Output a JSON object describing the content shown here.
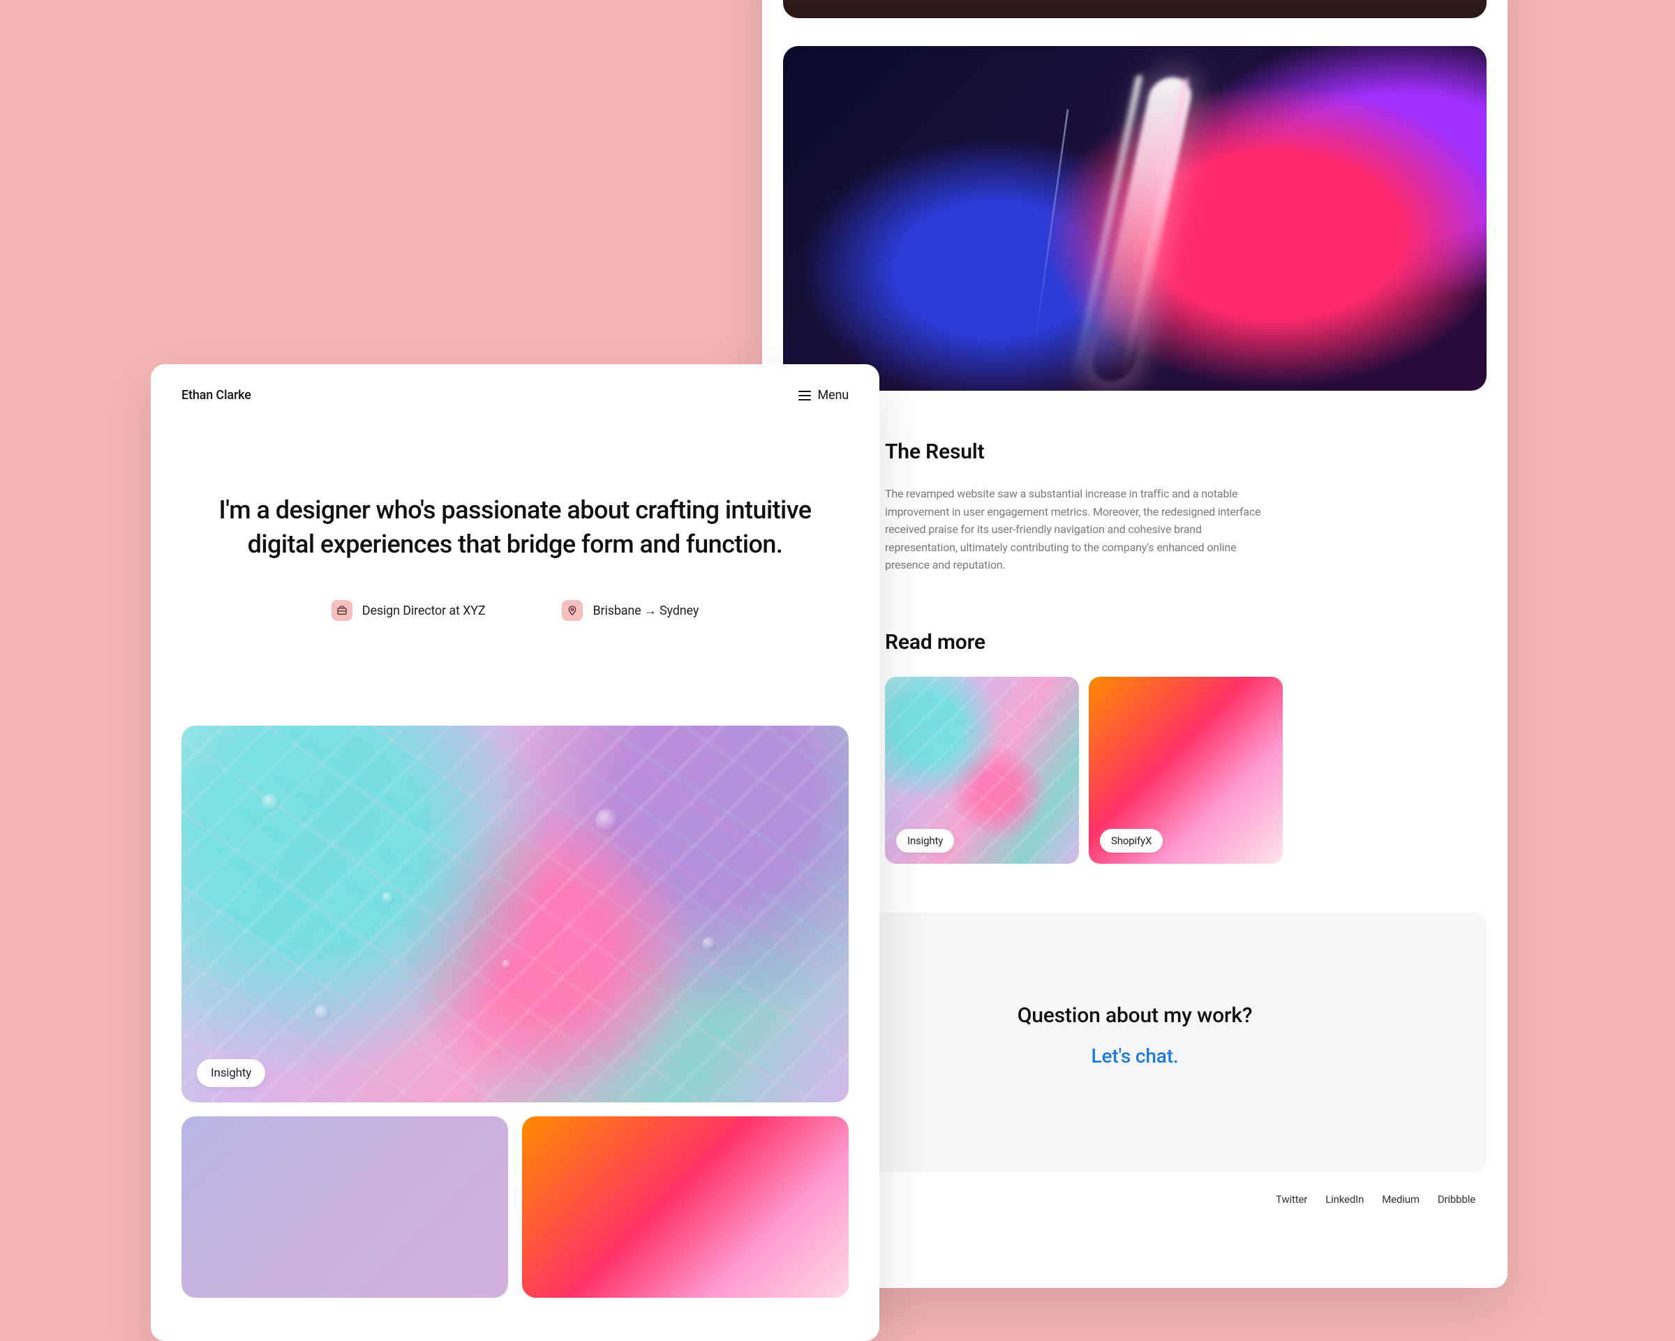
{
  "left": {
    "brand": "Ethan Clarke",
    "menu_label": "Menu",
    "hero": "I'm a designer who's passionate about crafting intuitive digital experiences that bridge form and function.",
    "role": "Design Director at XYZ",
    "location": "Brisbane → Sydney",
    "project_main_chip": "Insighty"
  },
  "right": {
    "result_heading": "The Result",
    "result_body": "The revamped website saw a substantial increase in traffic and a notable improvement in user engagement metrics. Moreover, the redesigned interface received praise for its user-friendly navigation and cohesive brand representation, ultimately contributing to the company's enhanced online presence and reputation.",
    "readmore_heading": "Read more",
    "cards": [
      {
        "label": "Insighty"
      },
      {
        "label": "ShopifyX"
      }
    ],
    "cta_question": "Question about my work?",
    "cta_link": "Let's chat.",
    "footer": [
      "Twitter",
      "LinkedIn",
      "Medium",
      "Dribbble"
    ]
  }
}
